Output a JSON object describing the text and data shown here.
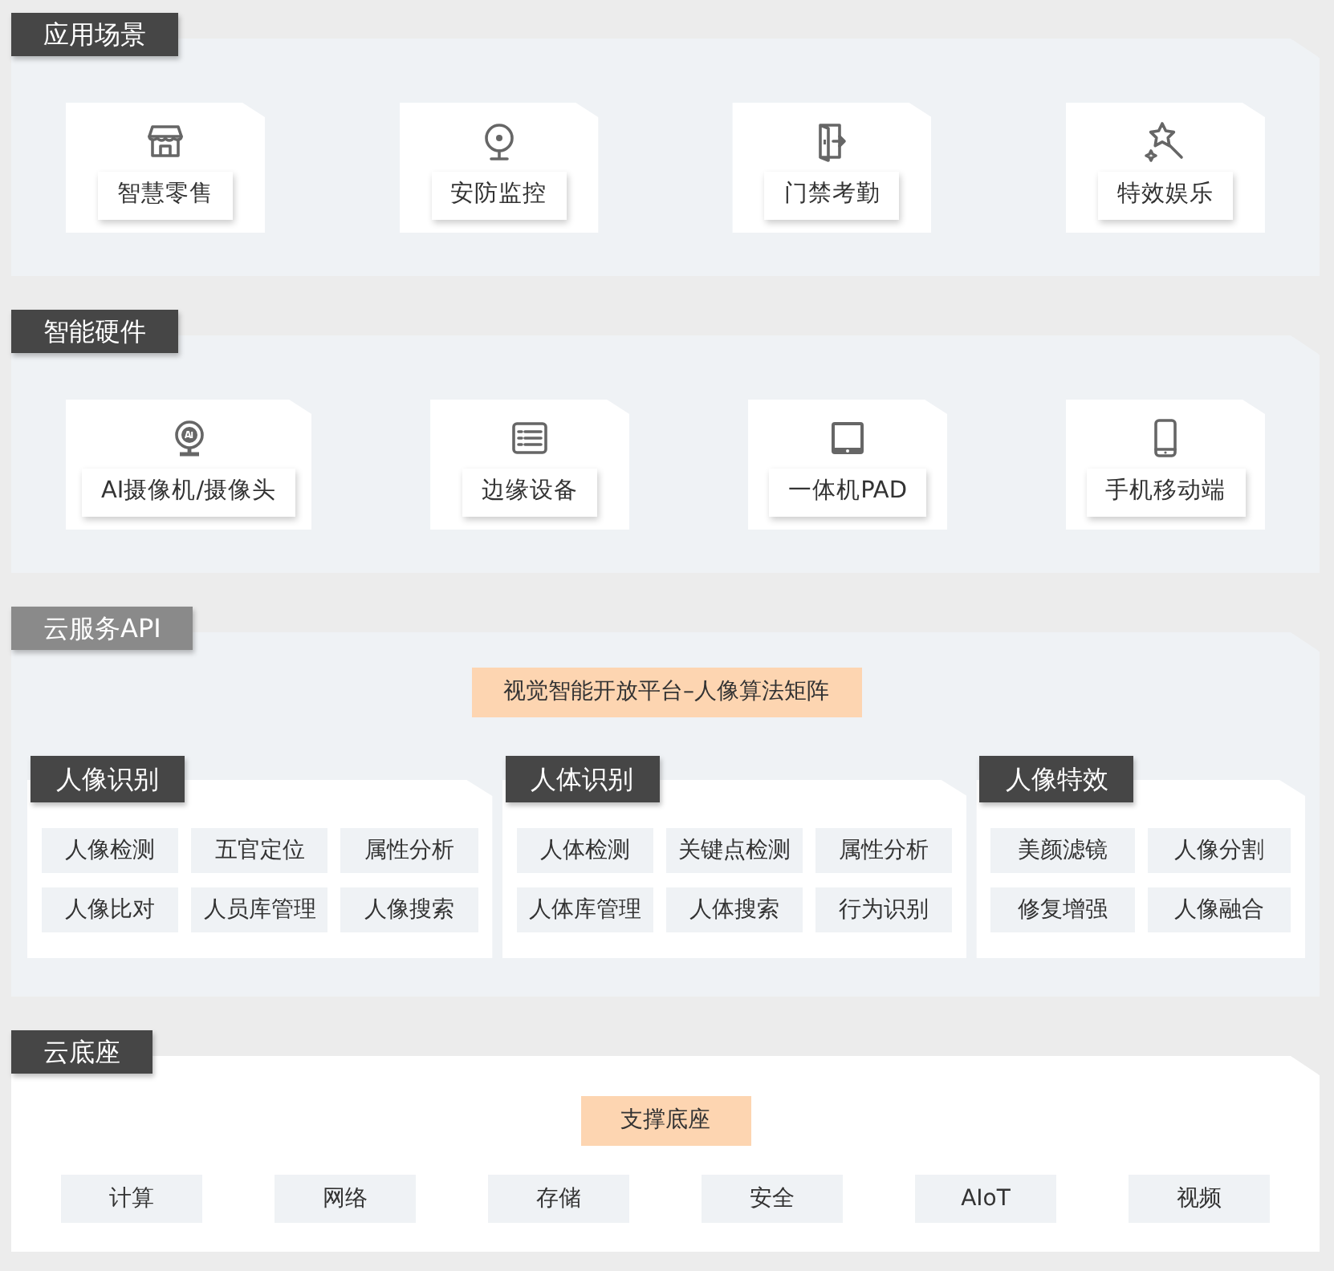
{
  "sections": [
    {
      "kind": "cards",
      "title": "应用场景",
      "color": "#464646",
      "cards": [
        {
          "label": "智慧零售"
        },
        {
          "label": "安防监控"
        },
        {
          "label": "门禁考勤"
        },
        {
          "label": "特效娱乐"
        }
      ]
    },
    {
      "kind": "cards",
      "title": "智能硬件",
      "color": "#464646",
      "cards": [
        {
          "label": "AI摄像机/摄像头"
        },
        {
          "label": "边缘设备"
        },
        {
          "label": "一体机PAD"
        },
        {
          "label": "手机移动端"
        }
      ]
    },
    {
      "kind": "api",
      "title": "云服务API",
      "color": "#8a8a8a",
      "banner": "视觉智能开放平台–人像算法矩阵",
      "groups": [
        {
          "title": "人像识别",
          "items": [
            "人像检测",
            "五官定位",
            "属性分析",
            "人像比对",
            "人员库管理",
            "人像搜索"
          ]
        },
        {
          "title": "人体识别",
          "items": [
            "人体检测",
            "关键点检测",
            "属性分析",
            "人体库管理",
            "人体搜索",
            "行为识别"
          ]
        },
        {
          "title": "人像特效",
          "items": [
            "美颜滤镜",
            "人像分割",
            "修复增强",
            "人像融合"
          ]
        }
      ]
    },
    {
      "kind": "base",
      "title": "云底座",
      "color": "#464646",
      "banner": "支撑底座",
      "items": [
        "计算",
        "网络",
        "存储",
        "安全",
        "AIoT",
        "视频"
      ]
    }
  ]
}
